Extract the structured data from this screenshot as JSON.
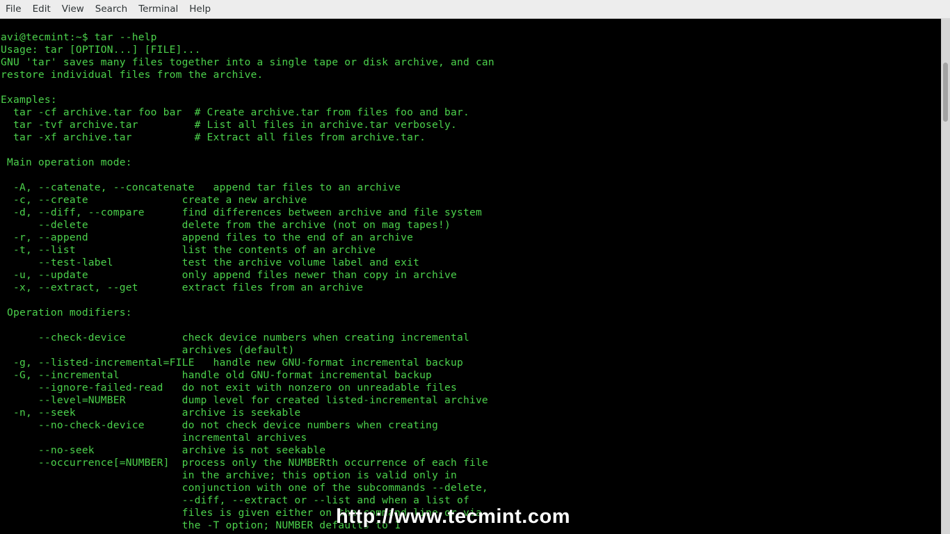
{
  "menubar": {
    "items": [
      "File",
      "Edit",
      "View",
      "Search",
      "Terminal",
      "Help"
    ]
  },
  "terminal": {
    "prompt": "avi@tecmint:~$ tar --help",
    "lines": [
      "avi@tecmint:~$ tar --help",
      "Usage: tar [OPTION...] [FILE]...",
      "GNU 'tar' saves many files together into a single tape or disk archive, and can",
      "restore individual files from the archive.",
      "",
      "Examples:",
      "  tar -cf archive.tar foo bar  # Create archive.tar from files foo and bar.",
      "  tar -tvf archive.tar         # List all files in archive.tar verbosely.",
      "  tar -xf archive.tar          # Extract all files from archive.tar.",
      "",
      " Main operation mode:",
      "",
      "  -A, --catenate, --concatenate   append tar files to an archive",
      "  -c, --create               create a new archive",
      "  -d, --diff, --compare      find differences between archive and file system",
      "      --delete               delete from the archive (not on mag tapes!)",
      "  -r, --append               append files to the end of an archive",
      "  -t, --list                 list the contents of an archive",
      "      --test-label           test the archive volume label and exit",
      "  -u, --update               only append files newer than copy in archive",
      "  -x, --extract, --get       extract files from an archive",
      "",
      " Operation modifiers:",
      "",
      "      --check-device         check device numbers when creating incremental",
      "                             archives (default)",
      "  -g, --listed-incremental=FILE   handle new GNU-format incremental backup",
      "  -G, --incremental          handle old GNU-format incremental backup",
      "      --ignore-failed-read   do not exit with nonzero on unreadable files",
      "      --level=NUMBER         dump level for created listed-incremental archive",
      "  -n, --seek                 archive is seekable",
      "      --no-check-device      do not check device numbers when creating",
      "                             incremental archives",
      "      --no-seek              archive is not seekable",
      "      --occurrence[=NUMBER]  process only the NUMBERth occurrence of each file",
      "                             in the archive; this option is valid only in",
      "                             conjunction with one of the subcommands --delete,",
      "                             --diff, --extract or --list and when a list of",
      "                             files is given either on the command line or via",
      "                             the -T option; NUMBER defaults to 1"
    ],
    "text_color": "#4cd24c",
    "background_color": "#000000"
  },
  "scrollbar": {
    "position_fraction": 0.08
  },
  "watermark": {
    "text": "http://www.tecmint.com"
  }
}
